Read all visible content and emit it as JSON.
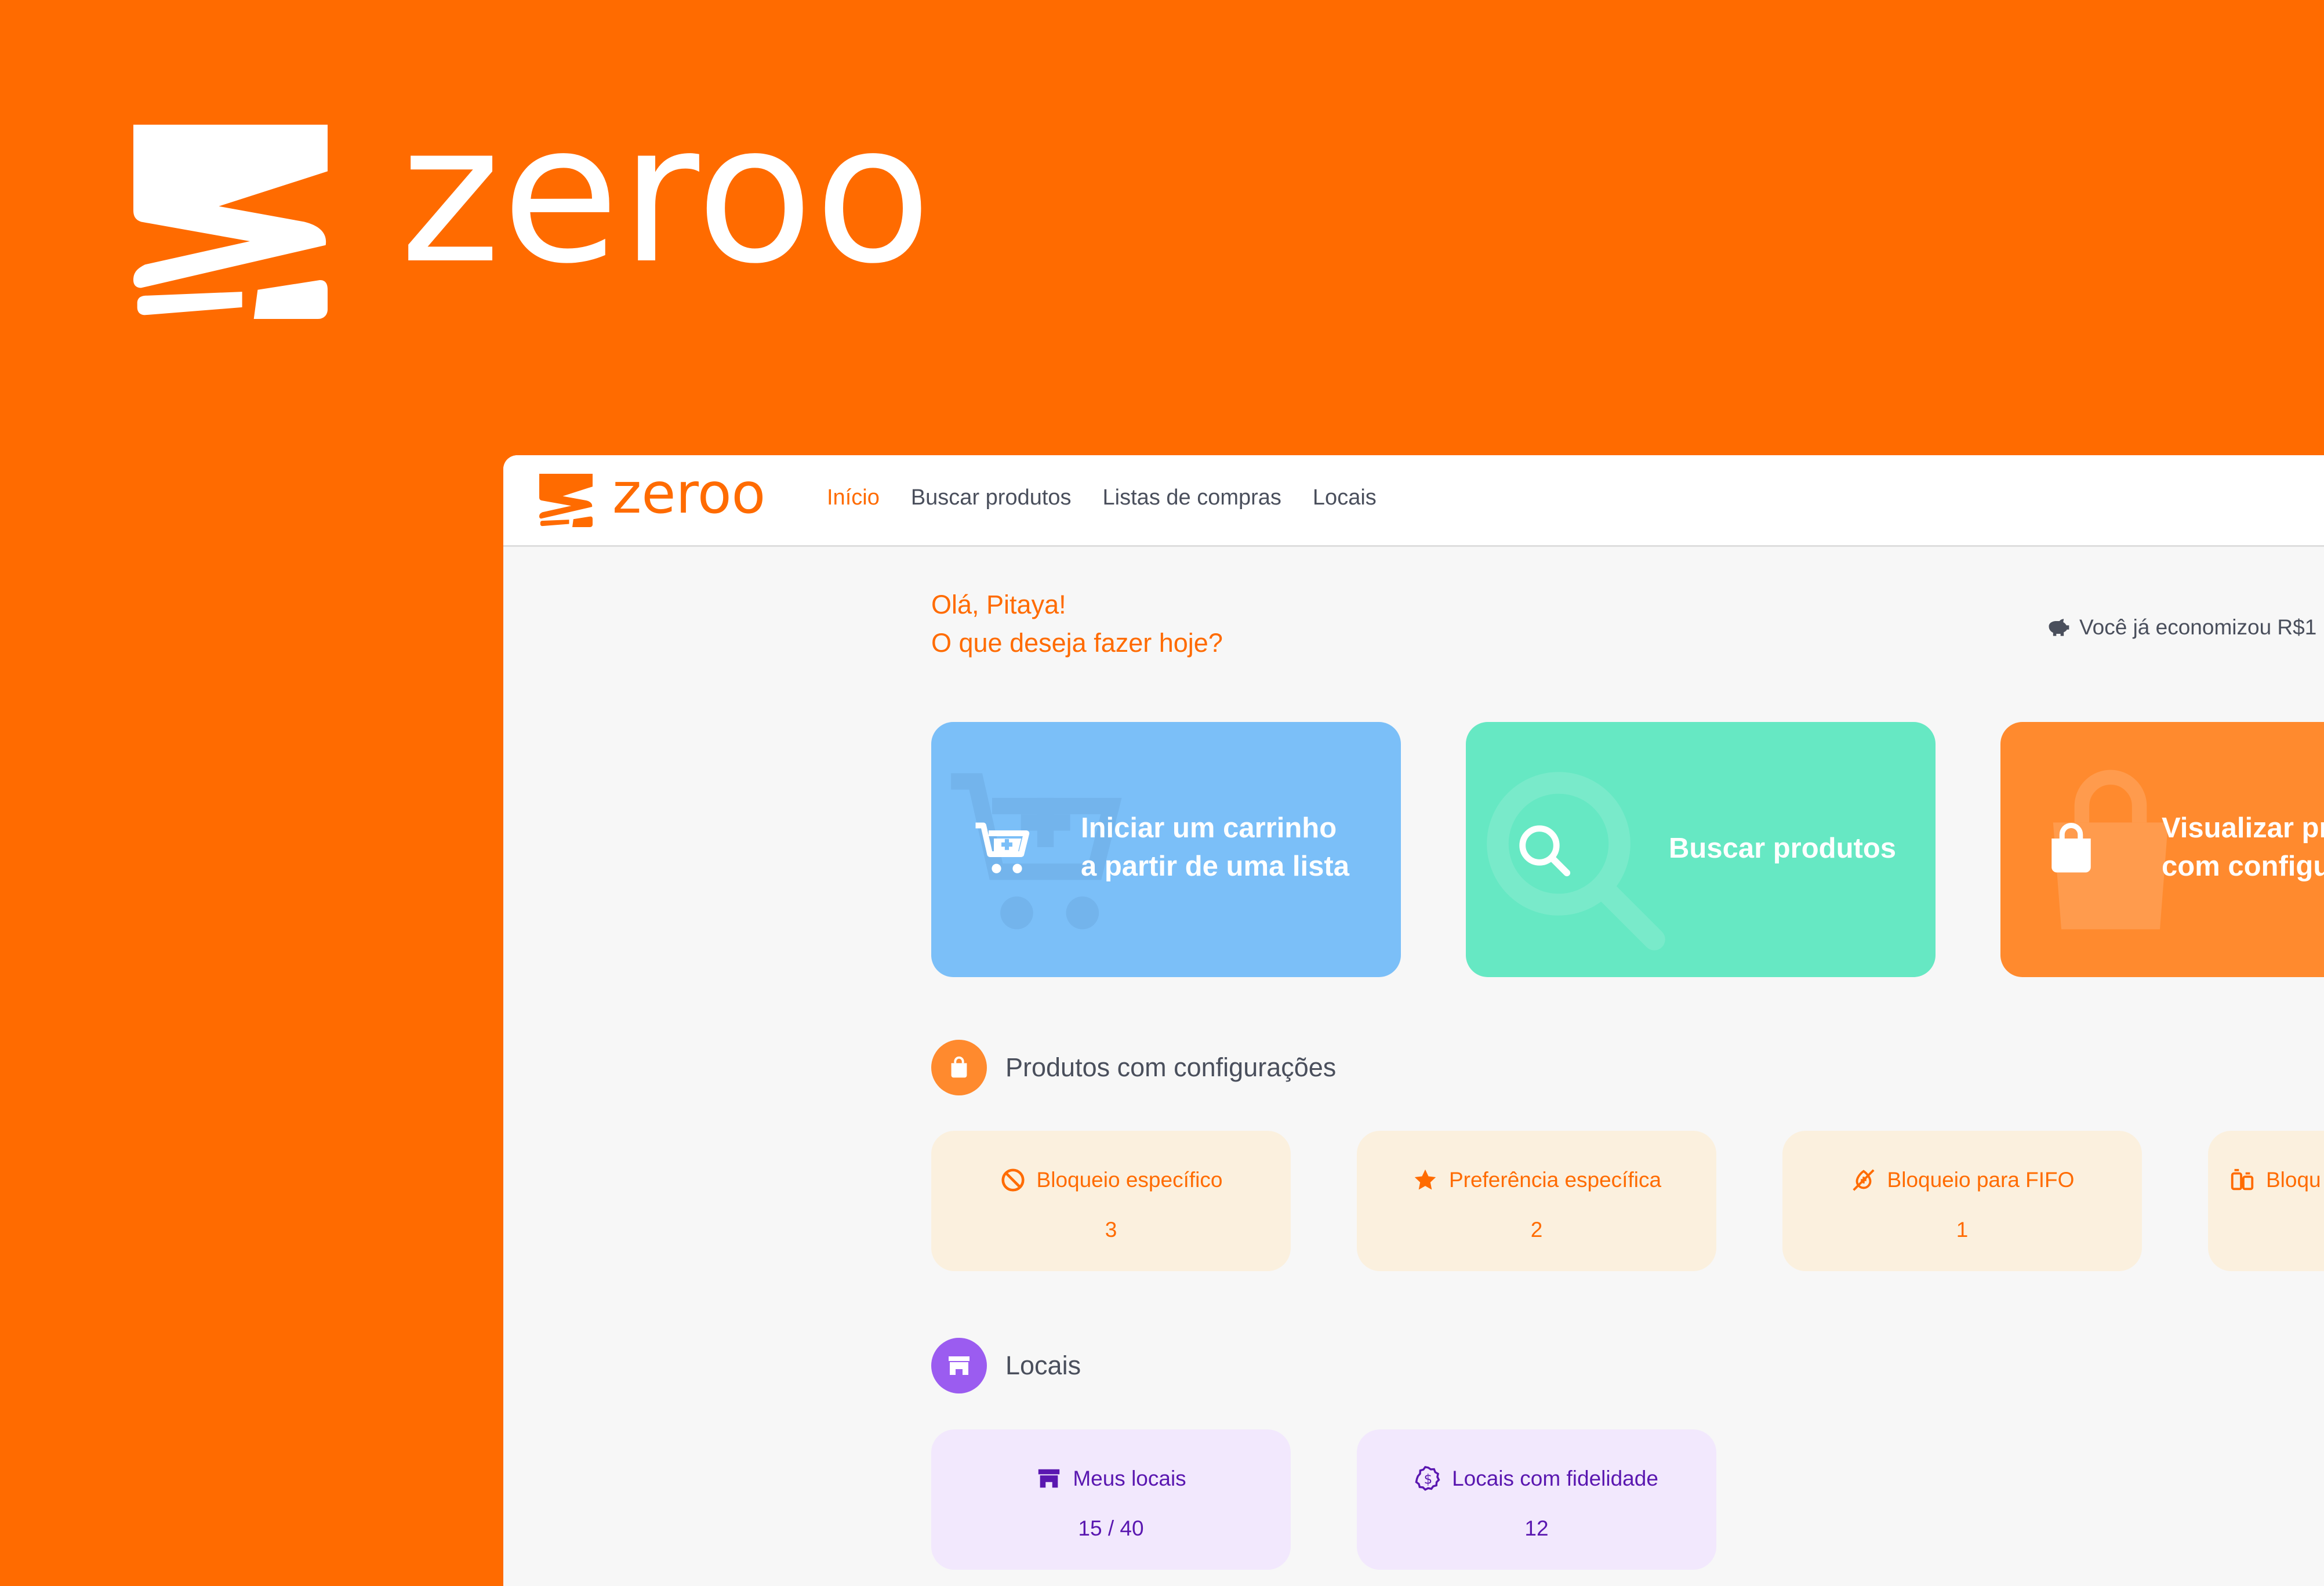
{
  "brand": {
    "name": "zeroo",
    "primary_color": "#FF6B00"
  },
  "nav": {
    "items": [
      {
        "label": "Início",
        "active": true
      },
      {
        "label": "Buscar produtos",
        "active": false
      },
      {
        "label": "Listas de compras",
        "active": false
      },
      {
        "label": "Locais",
        "active": false
      }
    ]
  },
  "greeting": {
    "line1": "Olá, Pitaya!",
    "line2": "O que deseja fazer hoje?"
  },
  "savings": {
    "icon": "piggy-bank-icon",
    "text": "Você já economizou R$1"
  },
  "actions": [
    {
      "line1": "Iniciar um carrinho",
      "line2": "a partir de uma lista",
      "icon": "cart-plus-icon",
      "color": "#7BBFF8"
    },
    {
      "line1": "Buscar produtos",
      "icon": "search-icon",
      "color": "#66E8C3"
    },
    {
      "line1": "Visualizar pr",
      "line2": "com configu",
      "icon": "bag-icon",
      "color": "#FF8A2E"
    }
  ],
  "products_section": {
    "title": "Produtos com configurações",
    "icon": "bag-icon",
    "cards": [
      {
        "label": "Bloqueio específico",
        "value": "3",
        "icon": "block-icon"
      },
      {
        "label": "Preferência específica",
        "value": "2",
        "icon": "star-icon"
      },
      {
        "label": "Bloqueio para FIFO",
        "value": "1",
        "icon": "fifo-block-icon"
      },
      {
        "label": "Bloqu",
        "icon": "boxes-icon"
      }
    ]
  },
  "locations_section": {
    "title": "Locais",
    "icon": "store-icon",
    "cards": [
      {
        "label": "Meus locais",
        "value": "15 / 40",
        "icon": "store-icon"
      },
      {
        "label": "Locais com fidelidade",
        "value": "12",
        "icon": "dollar-badge-icon"
      }
    ]
  }
}
